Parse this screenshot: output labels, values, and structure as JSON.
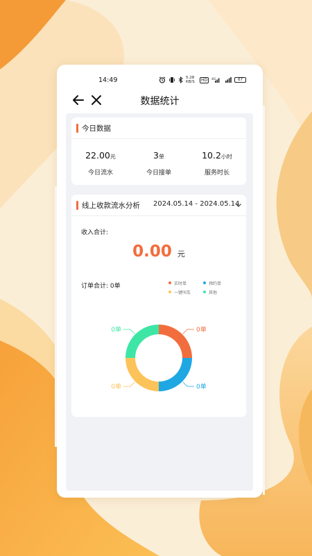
{
  "status_bar": {
    "time": "14:49",
    "icons": [
      "alarm-icon",
      "vibrate-icon",
      "bluetooth-icon",
      "network-speed-icon",
      "hd-icon",
      "signal-4g-icon",
      "signal-icon"
    ],
    "network_speed": "5.28 KB/S",
    "hd": "HD",
    "battery": "67"
  },
  "navbar": {
    "title": "数据统计",
    "icons": [
      "back-arrow-icon",
      "close-icon"
    ]
  },
  "today": {
    "title": "今日数据",
    "stats": [
      {
        "value": "22.00",
        "unit": "元",
        "label": "今日流水"
      },
      {
        "value": "3",
        "unit": "单",
        "label": "今日接单"
      },
      {
        "value": "10.2",
        "unit": "小时",
        "label": "服务时长"
      }
    ]
  },
  "analysis": {
    "title": "线上收款流水分析",
    "date_range": "2024.05.14 - 2024.05.14",
    "income_label": "收入合计:",
    "income_value": "0.00",
    "income_unit": "元",
    "order_total": "订单合计: 0单"
  },
  "chart_data": {
    "type": "pie",
    "style": "donut",
    "categories": [
      "实时单",
      "预约单",
      "一键叫车",
      "其他"
    ],
    "values": [
      0,
      0,
      0,
      0
    ],
    "labels": [
      "0单",
      "0单",
      "0单",
      "0单"
    ],
    "colors": [
      "#f26d3d",
      "#1ea7e3",
      "#fcc35a",
      "#3ee6a6"
    ],
    "legend_position": "top-right"
  },
  "colors": {
    "accent": "#f26d3d",
    "background_orange": "#f8a93e",
    "background_cream": "#fbeed7"
  }
}
